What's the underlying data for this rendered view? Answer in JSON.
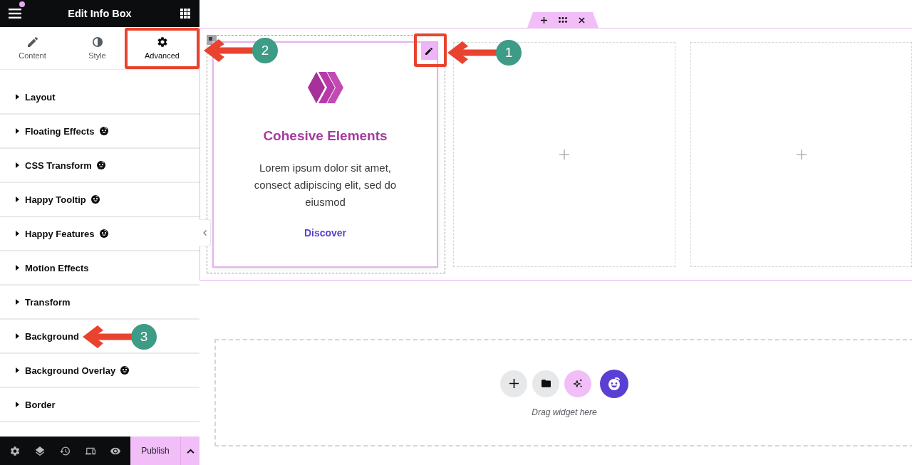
{
  "panel": {
    "title": "Edit Info Box"
  },
  "tabs": [
    {
      "label": "Content",
      "selected": false
    },
    {
      "label": "Style",
      "selected": false
    },
    {
      "label": "Advanced",
      "selected": true
    }
  ],
  "sections": [
    {
      "label": "Layout",
      "addon_badge": false
    },
    {
      "label": "Floating Effects",
      "addon_badge": true
    },
    {
      "label": "CSS Transform",
      "addon_badge": true
    },
    {
      "label": "Happy Tooltip",
      "addon_badge": true
    },
    {
      "label": "Happy Features",
      "addon_badge": true
    },
    {
      "label": "Motion Effects",
      "addon_badge": false
    },
    {
      "label": "Transform",
      "addon_badge": false
    },
    {
      "label": "Background",
      "addon_badge": false
    },
    {
      "label": "Background Overlay",
      "addon_badge": true
    },
    {
      "label": "Border",
      "addon_badge": false
    }
  ],
  "footer": {
    "publish": "Publish"
  },
  "canvas": {
    "columns": [
      {
        "kind": "info_box",
        "selected": true,
        "title": "Cohesive Elements",
        "text": "Lorem ipsum dolor sit amet, consect adipiscing elit, sed do eiusmod",
        "link": "Discover"
      },
      {
        "kind": "empty"
      },
      {
        "kind": "empty"
      }
    ],
    "drop_zone": {
      "hint": "Drag widget here"
    }
  },
  "annotations": [
    {
      "label": "1",
      "highlight": true
    },
    {
      "label": "2",
      "highlight": true
    },
    {
      "label": "3",
      "highlight": false
    }
  ]
}
